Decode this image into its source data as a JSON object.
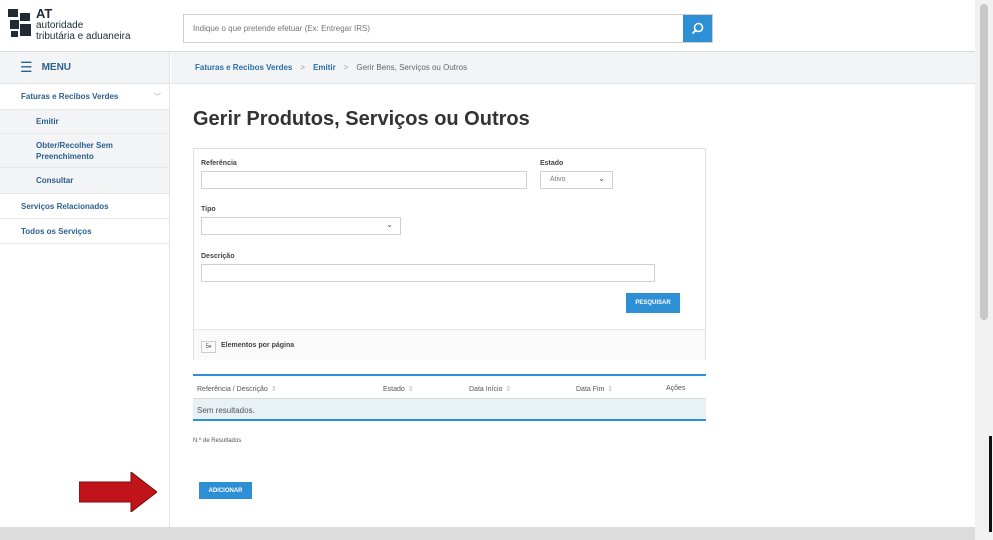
{
  "brand": {
    "line1": "AT",
    "line2": "autoridade",
    "line3": "tributária e aduaneira"
  },
  "search": {
    "placeholder": "Indique o que pretende efetuar (Ex: Entregar IRS)"
  },
  "sidebar": {
    "menu_label": "MENU",
    "items": [
      {
        "label": "Faturas e Recibos Verdes"
      },
      {
        "label": "Emitir"
      },
      {
        "label": "Obter/Recolher Sem Preenchimento"
      },
      {
        "label": "Consultar"
      },
      {
        "label": "Serviços Relacionados"
      },
      {
        "label": "Todos os Serviços"
      }
    ]
  },
  "breadcrumb": {
    "items": [
      "Faturas e Recibos Verdes",
      "Emitir",
      "Gerir Bens, Serviços ou Outros"
    ],
    "separator": ">"
  },
  "page": {
    "title": "Gerir Produtos, Serviços ou Outros"
  },
  "form": {
    "referencia_label": "Referência",
    "estado_label": "Estado",
    "estado_value": "Ativo",
    "tipo_label": "Tipo",
    "tipo_value": "",
    "descricao_label": "Descrição",
    "pesquisar_label": "PESQUISAR",
    "per_page_value": "5",
    "per_page_label": "Elementos por página"
  },
  "table": {
    "headers": [
      "Referência / Descrição",
      "Estado",
      "Data Início",
      "Data Fim",
      "Ações"
    ],
    "empty_text": "Sem resultados."
  },
  "results_label": "N.º de Resultados",
  "adicionar_label": "ADICIONAR",
  "colors": {
    "accent": "#2d8fd4",
    "link": "#2b6ea8",
    "annotation_arrow": "#c0141a"
  }
}
